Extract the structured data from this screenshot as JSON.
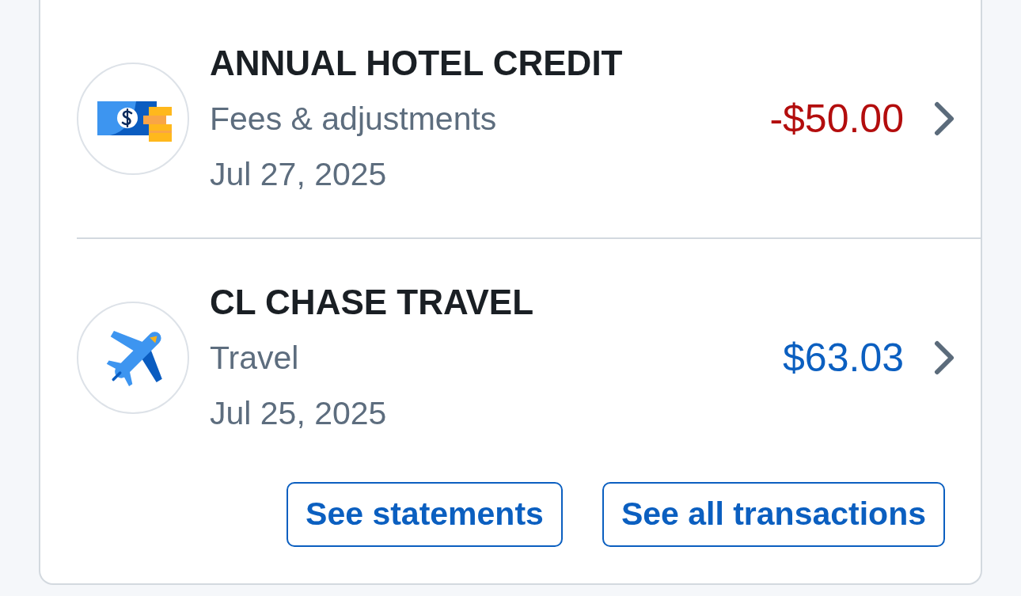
{
  "transactions": [
    {
      "kind": "fee",
      "title": "ANNUAL HOTEL CREDIT",
      "category": "Fees & adjustments",
      "date": "Jul 27, 2025",
      "amount": "-$50.00",
      "color": "#b30d0d"
    },
    {
      "kind": "travel",
      "title": "CL CHASE TRAVEL",
      "category": "Travel",
      "date": "Jul 25, 2025",
      "amount": "$63.03",
      "color": "#0b5fc0"
    }
  ],
  "buttons": [
    "See statements",
    "See all transactions"
  ]
}
